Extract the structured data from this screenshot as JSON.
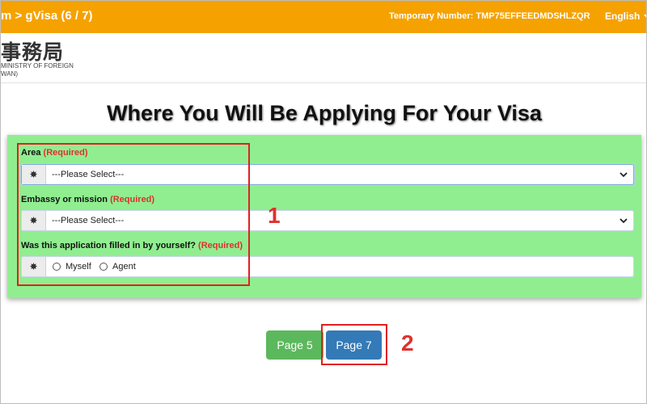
{
  "topbar": {
    "breadcrumb": "m > gVisa (6 / 7)",
    "temporary_number": "Temporary Number: TMP75EFFEEDMDSHLZQR",
    "language": "English"
  },
  "logo": {
    "cjk_text": "事務局",
    "line1": "MINISTRY OF FOREIGN",
    "line2": "WAN)"
  },
  "page_title": "Where You Will Be Applying For Your Visa",
  "form": {
    "required_label": "(Required)",
    "area": {
      "label": "Area",
      "value": "---Please Select---"
    },
    "embassy": {
      "label": "Embassy or mission",
      "value": "---Please Select---"
    },
    "filled_by": {
      "label": "Was this application filled in by yourself?",
      "options": [
        "Myself",
        "Agent"
      ]
    },
    "addon_icon": "✸"
  },
  "buttons": {
    "prev": "Page 5",
    "next": "Page 7"
  },
  "annotations": {
    "num1": "1",
    "num2": "2"
  },
  "colors": {
    "topbar": "#f5a200",
    "panel": "#90ee90",
    "prev_button": "#5cb85c",
    "next_button": "#337ab7",
    "annotation": "#e02020",
    "required": "#e0302e"
  }
}
